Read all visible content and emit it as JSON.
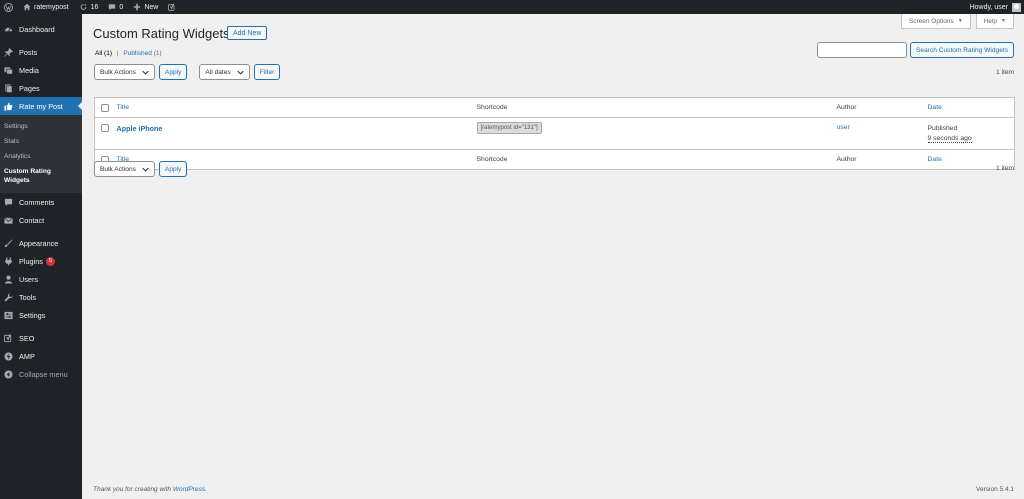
{
  "adminbar": {
    "site_name": "ratemypost",
    "updates_count": "16",
    "comments_count": "0",
    "new_label": "New",
    "greeting": "Howdy, user"
  },
  "sidebar": {
    "items": [
      {
        "label": "Dashboard",
        "icon": "dashboard-icon"
      },
      {
        "label": "Posts",
        "icon": "pin-icon"
      },
      {
        "label": "Media",
        "icon": "media-icon"
      },
      {
        "label": "Pages",
        "icon": "page-icon"
      },
      {
        "label": "Rate my Post",
        "icon": "thumbs-up-icon"
      },
      {
        "label": "Comments",
        "icon": "comment-icon"
      },
      {
        "label": "Contact",
        "icon": "mail-icon"
      },
      {
        "label": "Appearance",
        "icon": "brush-icon"
      },
      {
        "label": "Plugins",
        "icon": "plug-icon",
        "badge": "5"
      },
      {
        "label": "Users",
        "icon": "user-icon"
      },
      {
        "label": "Tools",
        "icon": "wrench-icon"
      },
      {
        "label": "Settings",
        "icon": "settings-icon"
      },
      {
        "label": "SEO",
        "icon": "yoast-icon"
      },
      {
        "label": "AMP",
        "icon": "amp-icon"
      },
      {
        "label": "Collapse menu",
        "icon": "collapse-icon"
      }
    ],
    "submenu": [
      "Settings",
      "Stats",
      "Analytics",
      "Custom Rating Widgets"
    ]
  },
  "screen_meta": {
    "screen_options": "Screen Options",
    "help": "Help"
  },
  "page": {
    "title": "Custom Rating Widgets",
    "add_new": "Add New",
    "filters": {
      "all": "All",
      "all_count": "(1)",
      "separator": "|",
      "published": "Published",
      "published_count": "(1)"
    },
    "search_button": "Search Custom Rating Widgets",
    "search_value": "",
    "bulk_actions": "Bulk Actions",
    "apply": "Apply",
    "all_dates": "All dates",
    "filter": "Filter",
    "items_count": "1 item"
  },
  "table": {
    "columns": {
      "title": "Title",
      "shortcode": "Shortcode",
      "author": "Author",
      "date": "Date"
    },
    "rows": [
      {
        "title": "Apple iPhone",
        "shortcode": "[ratemypost id=\"131\"]",
        "author": "user",
        "status": "Published",
        "date": "9 seconds ago"
      }
    ]
  },
  "footer": {
    "thanks_prefix": "Thank you for creating with ",
    "wordpress_link": "WordPress",
    "thanks_suffix": ".",
    "version": "Version 5.4.1"
  },
  "colors": {
    "admin_dark": "#1d2327",
    "accent": "#2271b1",
    "badge": "#d63638"
  }
}
